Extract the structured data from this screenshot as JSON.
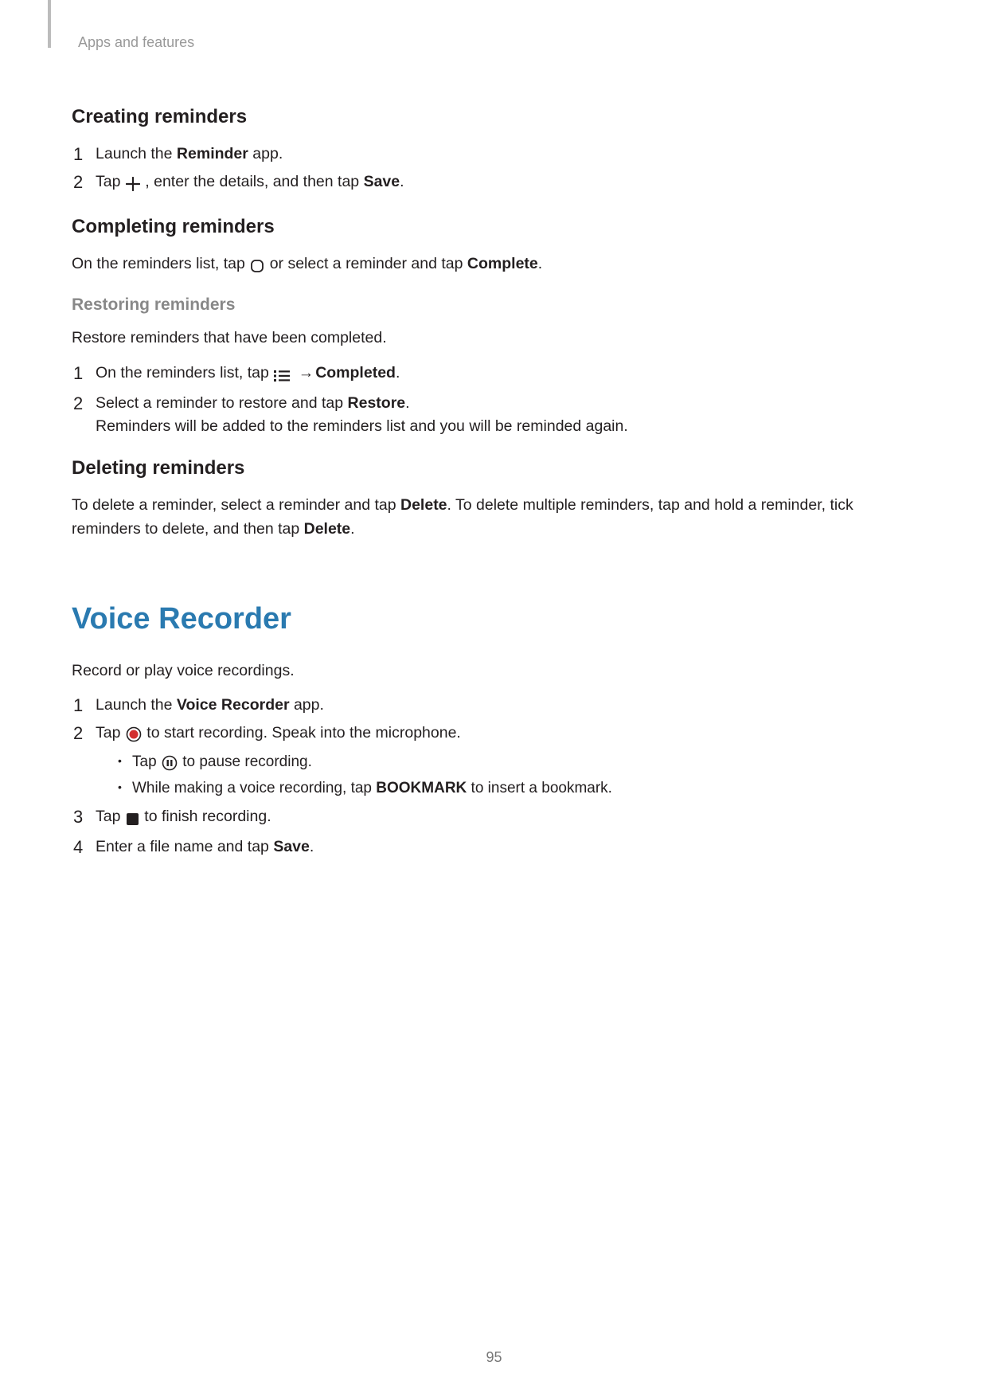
{
  "header": {
    "breadcrumb": "Apps and features"
  },
  "page_number": "95",
  "creating": {
    "title": "Creating reminders",
    "steps": {
      "s1": {
        "pre": "Launch the ",
        "bold": "Reminder",
        "post": " app."
      },
      "s2": {
        "pre": "Tap ",
        "mid": ", enter the details, and then tap ",
        "bold": "Save",
        "post": "."
      }
    }
  },
  "completing": {
    "title": "Completing reminders",
    "body": {
      "pre": "On the reminders list, tap ",
      "mid": " or select a reminder and tap ",
      "bold": "Complete",
      "post": "."
    }
  },
  "restoring": {
    "title": "Restoring reminders",
    "intro": "Restore reminders that have been completed.",
    "steps": {
      "s1": {
        "pre": "On the reminders list, tap ",
        "arrow": " → ",
        "bold": "Completed",
        "post": "."
      },
      "s2": {
        "line1_pre": "Select a reminder to restore and tap ",
        "line1_bold": "Restore",
        "line1_post": ".",
        "line2": "Reminders will be added to the reminders list and you will be reminded again."
      }
    }
  },
  "deleting": {
    "title": "Deleting reminders",
    "body": {
      "pre": "To delete a reminder, select a reminder and tap ",
      "bold1": "Delete",
      "mid": ". To delete multiple reminders, tap and hold a reminder, tick reminders to delete, and then tap ",
      "bold2": "Delete",
      "post": "."
    }
  },
  "voice_recorder": {
    "title": "Voice Recorder",
    "intro": "Record or play voice recordings.",
    "steps": {
      "s1": {
        "pre": "Launch the ",
        "bold": "Voice Recorder",
        "post": " app."
      },
      "s2": {
        "pre": "Tap ",
        "post": " to start recording. Speak into the microphone.",
        "sub1": {
          "pre": "Tap ",
          "post": " to pause recording."
        },
        "sub2": {
          "pre": "While making a voice recording, tap ",
          "bold": "BOOKMARK",
          "post": " to insert a bookmark."
        }
      },
      "s3": {
        "pre": "Tap ",
        "post": " to finish recording."
      },
      "s4": {
        "pre": "Enter a file name and tap ",
        "bold": "Save",
        "post": "."
      }
    }
  }
}
